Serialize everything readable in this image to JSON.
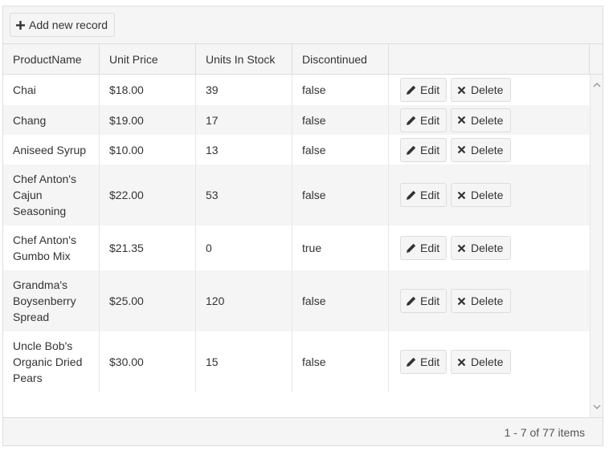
{
  "toolbar": {
    "add_label": "Add new record",
    "add_icon": "plus-icon"
  },
  "columns": {
    "product_name": "ProductName",
    "unit_price": "Unit Price",
    "units_in_stock": "Units In Stock",
    "discontinued": "Discontinued"
  },
  "rows": [
    {
      "name": "Chai",
      "price": "$18.00",
      "stock": "39",
      "discontinued": "false"
    },
    {
      "name": "Chang",
      "price": "$19.00",
      "stock": "17",
      "discontinued": "false"
    },
    {
      "name": "Aniseed Syrup",
      "price": "$10.00",
      "stock": "13",
      "discontinued": "false"
    },
    {
      "name": "Chef Anton's Cajun Seasoning",
      "price": "$22.00",
      "stock": "53",
      "discontinued": "false"
    },
    {
      "name": "Chef Anton's Gumbo Mix",
      "price": "$21.35",
      "stock": "0",
      "discontinued": "true"
    },
    {
      "name": "Grandma's Boysenberry Spread",
      "price": "$25.00",
      "stock": "120",
      "discontinued": "false"
    },
    {
      "name": "Uncle Bob's Organic Dried Pears",
      "price": "$30.00",
      "stock": "15",
      "discontinued": "false"
    }
  ],
  "commands": {
    "edit_label": "Edit",
    "delete_label": "Delete",
    "edit_icon": "pencil-icon",
    "delete_icon": "close-icon"
  },
  "pager": {
    "info": "1 - 7 of 77 items"
  },
  "colors": {
    "header_bg": "#f5f5f5",
    "alt_row_bg": "#f5f5f5",
    "border": "#dddddd",
    "text": "#333333"
  }
}
